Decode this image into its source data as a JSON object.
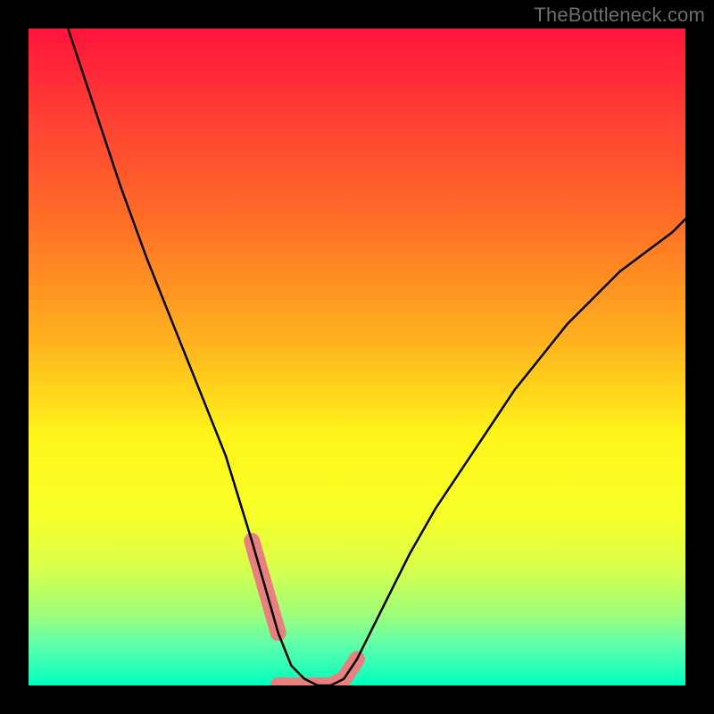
{
  "watermark_text": "TheBottleneck.com",
  "gradient": {
    "stops": [
      {
        "offset": "0%",
        "color": "#ff143c"
      },
      {
        "offset": "14%",
        "color": "#ff4133"
      },
      {
        "offset": "30%",
        "color": "#ff7026"
      },
      {
        "offset": "48%",
        "color": "#ffb41e"
      },
      {
        "offset": "62%",
        "color": "#fff51a"
      },
      {
        "offset": "74%",
        "color": "#f8ff28"
      },
      {
        "offset": "82%",
        "color": "#d9ff4b"
      },
      {
        "offset": "89%",
        "color": "#a0ff7a"
      },
      {
        "offset": "94%",
        "color": "#5cffac"
      },
      {
        "offset": "100%",
        "color": "#00ffc0"
      }
    ]
  },
  "highlight_color": "#e88080",
  "curve_color": "#000000",
  "chart_data": {
    "type": "line",
    "title": "",
    "xlabel": "",
    "ylabel": "",
    "xlim": [
      0,
      100
    ],
    "ylim": [
      0,
      100
    ],
    "series": [
      {
        "name": "bottleneck-curve",
        "x": [
          6,
          10,
          14,
          18,
          22,
          26,
          30,
          34,
          36,
          38,
          40,
          42,
          44,
          46,
          48,
          50,
          54,
          58,
          62,
          66,
          70,
          74,
          78,
          82,
          86,
          90,
          94,
          98,
          100
        ],
        "y": [
          100,
          88,
          76,
          65,
          55,
          45,
          35,
          22,
          15,
          8,
          3,
          1,
          0,
          0,
          1,
          4,
          12,
          20,
          27,
          33,
          39,
          45,
          50,
          55,
          59,
          63,
          66,
          69,
          71
        ]
      }
    ],
    "highlighted_ranges": [
      {
        "x_start": 34,
        "x_end": 38
      },
      {
        "x_start": 46,
        "x_end": 50
      }
    ],
    "flat_bottom": {
      "x_start": 38,
      "x_end": 46,
      "y": 0
    }
  }
}
